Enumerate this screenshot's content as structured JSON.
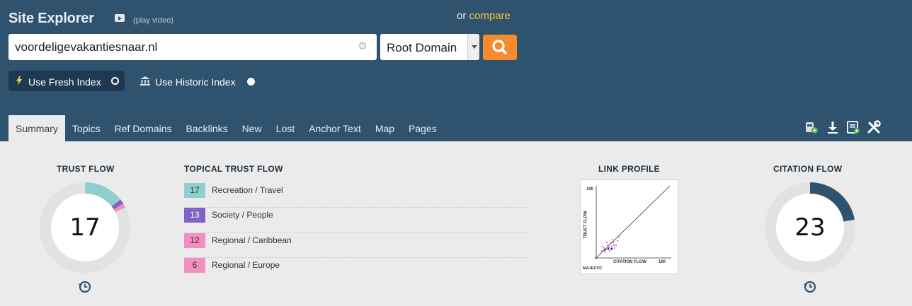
{
  "header": {
    "title": "Site Explorer",
    "play_video": "(play video)",
    "or_text": "or",
    "compare_link": "compare"
  },
  "search": {
    "value": "voordeligevakantiesnaar.nl",
    "scope": "Root Domain"
  },
  "index": {
    "fresh_label": "Use Fresh Index",
    "historic_label": "Use Historic Index",
    "selected": "fresh"
  },
  "tabs": [
    "Summary",
    "Topics",
    "Ref Domains",
    "Backlinks",
    "New",
    "Lost",
    "Anchor Text",
    "Map",
    "Pages"
  ],
  "active_tab": "Summary",
  "toolbar_icons": [
    "add-to-bucket-icon",
    "download-icon",
    "report-icon",
    "tools-icon"
  ],
  "trust_flow": {
    "heading": "TRUST FLOW",
    "value": "17"
  },
  "topical_trust_flow": {
    "heading": "TOPICAL TRUST FLOW",
    "items": [
      {
        "value": "17",
        "label": "Recreation / Travel",
        "color": "#8fcfcf"
      },
      {
        "value": "13",
        "label": "Society / People",
        "color": "#7f63c8"
      },
      {
        "value": "12",
        "label": "Regional / Caribbean",
        "color": "#f58ec0"
      },
      {
        "value": "6",
        "label": "Regional / Europe",
        "color": "#f58ec0"
      }
    ]
  },
  "link_profile": {
    "heading": "LINK PROFILE",
    "y_axis_label": "TRUST FLOW",
    "x_axis_label": "CITATION FLOW",
    "y_max": "100",
    "x_max": "100",
    "brand": "MAJESTIC"
  },
  "citation_flow": {
    "heading": "CITATION FLOW",
    "value": "23"
  },
  "colors": {
    "header_bg": "#2f536e",
    "compare_link": "#f3c43a",
    "search_button": "#f58b2c",
    "citation_ring": "#2f536e",
    "ring_track": "#e2e2e2"
  }
}
